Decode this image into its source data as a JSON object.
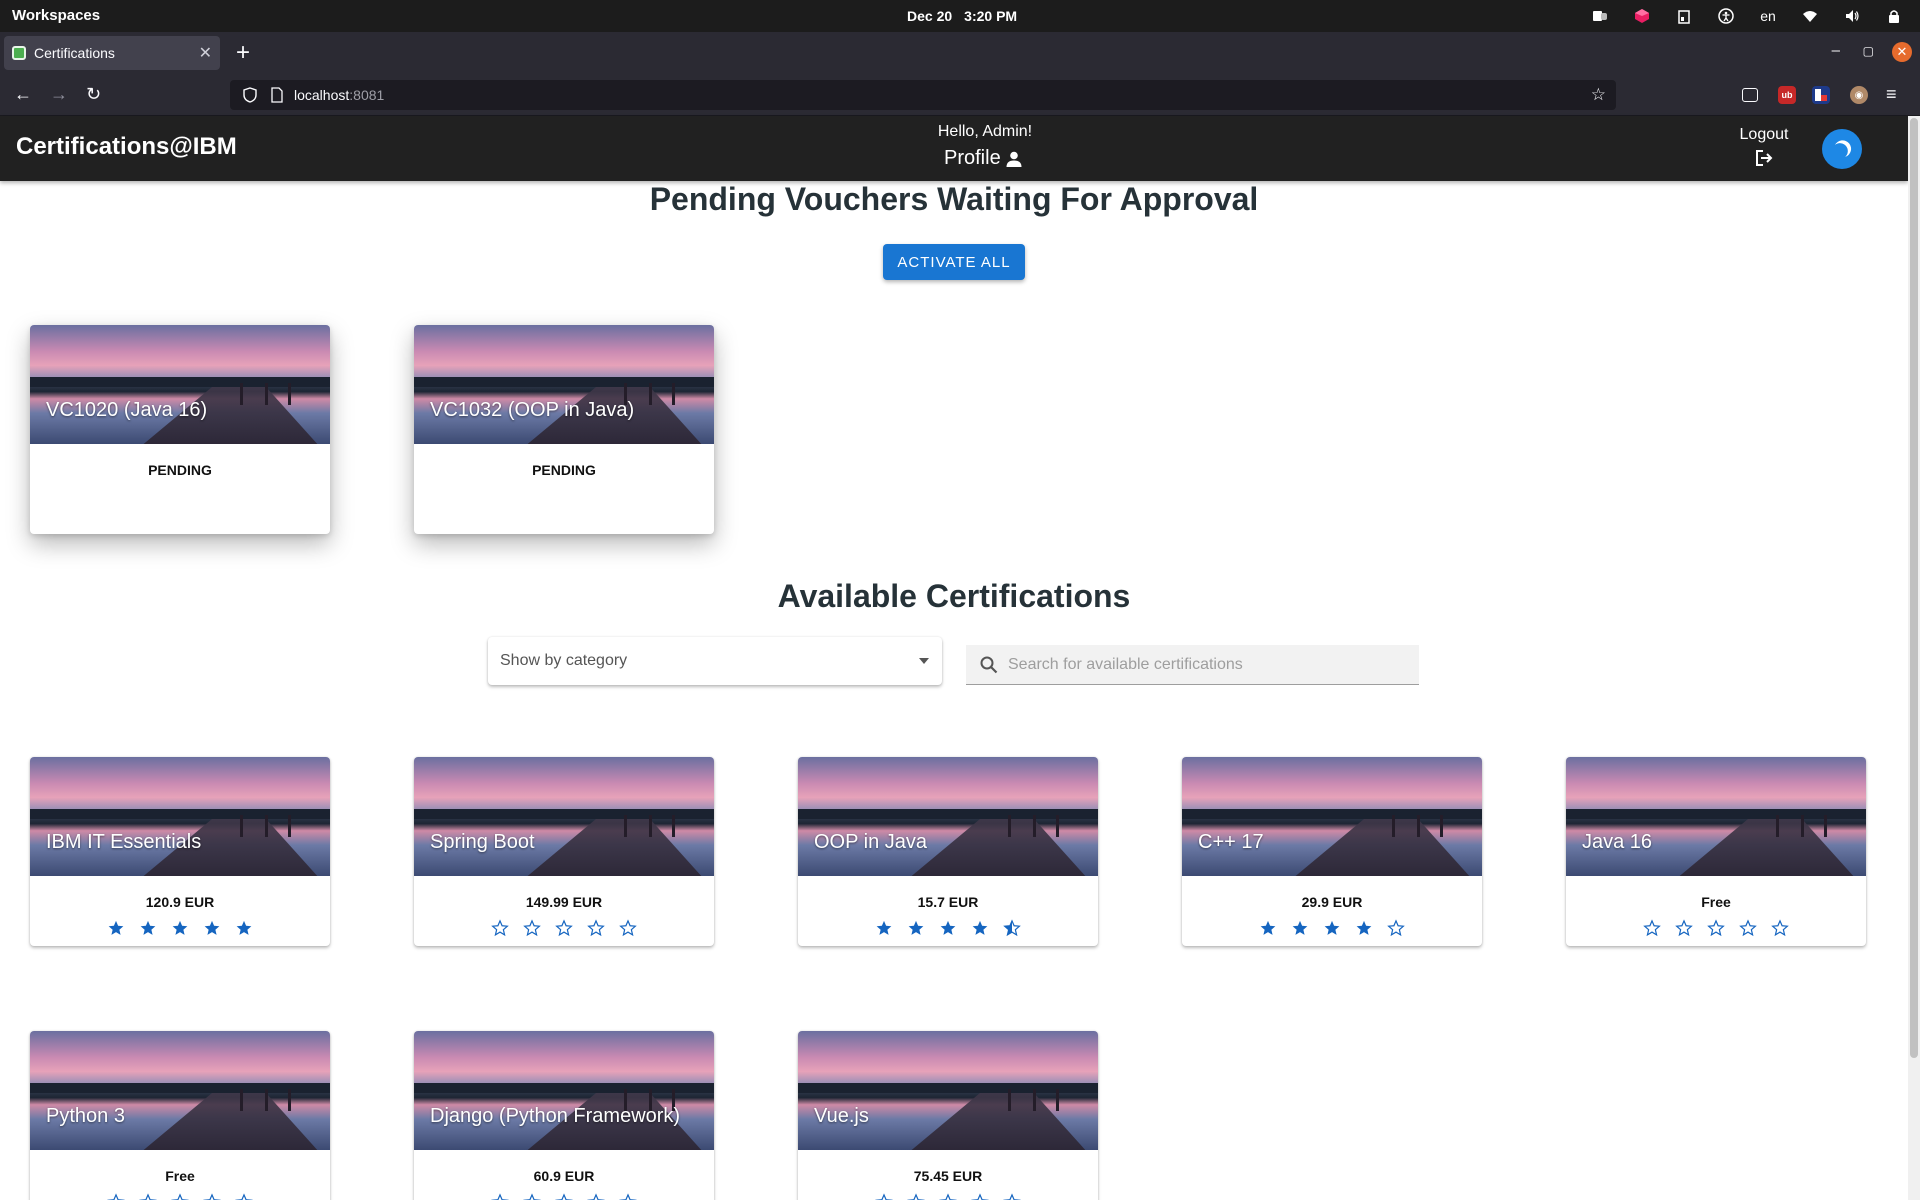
{
  "os": {
    "workspaces_label": "Workspaces",
    "date": "Dec 20",
    "time": "3:20 PM",
    "language": "en"
  },
  "browser": {
    "tab_title": "Certifications",
    "url_host": "localhost",
    "url_port": ":8081"
  },
  "header": {
    "brand": "Certifications@IBM",
    "greeting": "Hello, Admin!",
    "profile_label": "Profile",
    "logout_label": "Logout"
  },
  "pending": {
    "title": "Pending Vouchers Waiting For Approval",
    "activate_all_label": "ACTIVATE ALL",
    "vouchers": [
      {
        "name": "VC1020 (Java 16)",
        "status": "PENDING"
      },
      {
        "name": "VC1032 (OOP in Java)",
        "status": "PENDING"
      }
    ]
  },
  "available": {
    "title": "Available Certifications",
    "category_select_value": "Show by category",
    "search_placeholder": "Search for available certifications",
    "certifications": [
      {
        "name": "IBM IT Essentials",
        "price": "120.9 EUR",
        "rating": 5
      },
      {
        "name": "Spring Boot",
        "price": "149.99 EUR",
        "rating": 0
      },
      {
        "name": "OOP in Java",
        "price": "15.7 EUR",
        "rating": 4.5
      },
      {
        "name": "C++ 17",
        "price": "29.9 EUR",
        "rating": 4
      },
      {
        "name": "Java 16",
        "price": "Free",
        "rating": 0
      },
      {
        "name": "Python 3",
        "price": "Free",
        "rating": 0
      },
      {
        "name": "Django (Python Framework)",
        "price": "60.9 EUR",
        "rating": 0
      },
      {
        "name": "Vue.js",
        "price": "75.45 EUR",
        "rating": 0
      }
    ]
  },
  "colors": {
    "accent": "#1976d2",
    "header_bg": "#212121",
    "star": "#1565c0"
  }
}
